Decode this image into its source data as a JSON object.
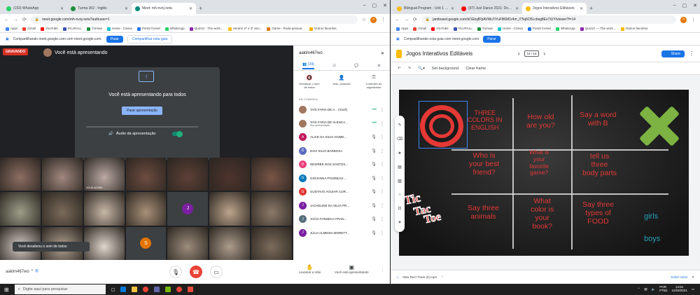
{
  "left_browser": {
    "tabs": [
      {
        "title": "(153) WhatsApp",
        "color": "#25d366",
        "active": false
      },
      {
        "title": "Turma 302 - Inglês",
        "color": "#1e8e3e",
        "active": false
      },
      {
        "title": "Meet: mh-nvnj-xeta",
        "color": "#00897b",
        "active": true
      }
    ],
    "url": "meet.google.com/mh-nvnj-xeta?authuser=1",
    "bookmarks": [
      "Apps",
      "Gmail",
      "YouTube",
      "PLURALL",
      "Turmas",
      "Home - Canva",
      "Portal Cersel",
      "WhatsApp",
      "Quizizz - The work...",
      "Horário 2º e 3º ano...",
      "Game - Roda pessoa...",
      "Outros favoritos"
    ],
    "share_text": "Compartilhando meet.google.com com meet.google.com.",
    "share_stop": "Parar",
    "share_switch": "Compartilhar esta guia"
  },
  "meet": {
    "recording": "GRAVANDO",
    "presenter": "Você está apresentando",
    "presenting_all": "Você está apresentando para todos",
    "stop_presenting": "Parar apresentação",
    "presentation_audio": "Áudio da apresentação",
    "muted_toast": "Você desativou o som de todos",
    "tile_name": "JÚLIA ALMEI...",
    "tile_letters": [
      {
        "letter": "J",
        "color": "#7b1fa2"
      },
      {
        "letter": "S",
        "color": "#e37400"
      }
    ],
    "meeting_code": "aaklm467wo",
    "raise_hand": "Levantar a mão",
    "you_presenting": "Você está apresentando",
    "panel": {
      "title": "aaklm467wo",
      "tab_people": "(24)",
      "action_mute": "Desativar o som de todos",
      "action_add": "Adic. pessoas",
      "action_host": "Controles do organizador",
      "section": "EM CHAMADA",
      "people": [
        {
          "name": "TAÍS FARIA DE A...",
          "sub": "(Você)",
          "initial": "",
          "color": "#a07860"
        },
        {
          "name": "TAÍS FARIA DE ALENCA...",
          "sub": "Sua apresentação",
          "initial": "",
          "color": "#a07860"
        },
        {
          "name": "ALICE DA SILVA GOME...",
          "sub": "",
          "initial": "A",
          "color": "#c2185b"
        },
        {
          "name": "DAVI SILVA BARBOSA",
          "sub": "",
          "initial": "D",
          "color": "#5c6bc0"
        },
        {
          "name": "DESIRÉE DOS SANTOS...",
          "sub": "",
          "initial": "D",
          "color": "#ec407a"
        },
        {
          "name": "GIOVANNA POURBAIX ...",
          "sub": "",
          "initial": "G",
          "color": "#0277bd"
        },
        {
          "name": "GUSTAVO AGUIAR COR...",
          "sub": "",
          "initial": "G",
          "color": "#e53935"
        },
        {
          "name": "JACKELINE DA SILVA PR...",
          "sub": "",
          "initial": "J",
          "color": "#7b1fa2"
        },
        {
          "name": "JOÃO FONSECA FRAN...",
          "sub": "",
          "initial": "J",
          "color": "#546e7a"
        },
        {
          "name": "JÚLIA ALMEIDA MORETT...",
          "sub": "",
          "initial": "J",
          "color": "#7b1fa2"
        }
      ]
    }
  },
  "right_browser": {
    "tabs": [
      {
        "title": "Bilingual Program - Unit 1 - Aprender",
        "color": "#fbbc04",
        "active": false
      },
      {
        "title": "(97) Just Dance 2021: Don't Start Now",
        "color": "#ff0000",
        "active": false
      },
      {
        "title": "Jogos Interativos Editáveis",
        "color": "#fbbc04",
        "active": true
      }
    ],
    "url": "jamboard.google.com/d/1EtsjfPpAVWuTiYuFB6M1r4m_lT5q6O5Lcbsg8Ex7IUY/viewer?f=14",
    "bookmarks": [
      "Apps",
      "Gmail",
      "YouTube",
      "PLURALL",
      "Turmas",
      "Home - Canva",
      "Portal Cersel",
      "WhatsApp",
      "Quizizz — The work...",
      "Outros favoritos"
    ],
    "share_text": "Compartilhando esta guia com meet.google.com",
    "share_stop": "Parar"
  },
  "jamboard": {
    "title": "Jogos Interativos Editáveis",
    "frame": "14 / 14",
    "share": "Share",
    "set_background": "Set background",
    "clear_frame": "Clear frame",
    "questions": [
      "THREE\nCOLORS IN\nENGLISH",
      "How old\nare you?",
      "Say a word\nwith B",
      "Who is\nyour best\nfriend?",
      "What is\nyour\nfavorite\ngame?",
      "tell us\nthree\nbody parts",
      "Say three\nanimals",
      "What\ncolor is\nyour\nbook?",
      "Say three\ntypes of\nFOOD"
    ],
    "logo_words": [
      "Tic",
      "Tac",
      "Toe"
    ],
    "girls": "girls",
    "boys": "boys",
    "download": "New Rect Track (0).mp3",
    "show_all": "Exibir todos"
  },
  "taskbar": {
    "search": "Digite aqui para pesquisar",
    "lang": "POR\nPTB2",
    "time": "14:51",
    "date": "11/03/2021"
  }
}
